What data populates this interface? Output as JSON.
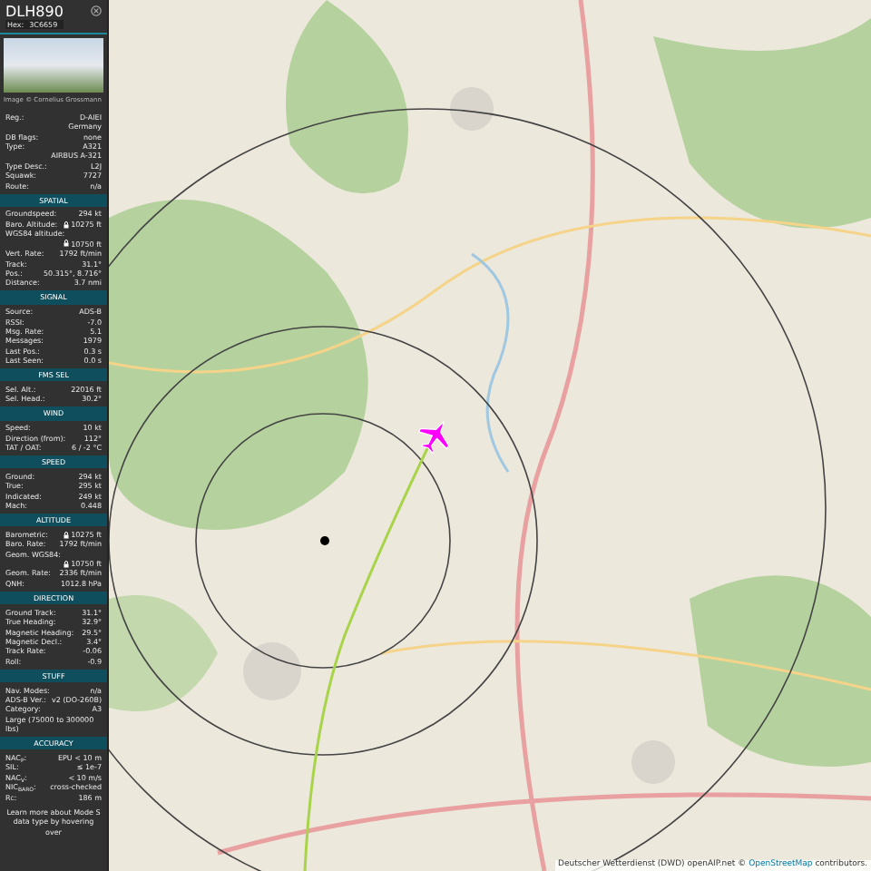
{
  "header": {
    "callsign": "DLH890",
    "hex_label": "Hex:",
    "hex": "3C6659"
  },
  "photo": {
    "caption": "Image © Cornelius Grossmann"
  },
  "info": [
    {
      "label": "Reg.:",
      "values": [
        "D-AIEI",
        "Germany"
      ],
      "locked": false
    },
    {
      "label": "DB flags:",
      "values": [
        "none"
      ],
      "locked": false
    },
    {
      "label": "Type:",
      "values": [
        "A321",
        "AIRBUS A-321"
      ],
      "locked": false
    },
    {
      "label": "Type Desc.:",
      "values": [
        "L2J"
      ],
      "locked": false
    },
    {
      "label": "Squawk:",
      "values": [
        "7727"
      ],
      "locked": false
    },
    {
      "label": "Route:",
      "values": [
        "n/a"
      ],
      "locked": false
    }
  ],
  "sections": [
    {
      "title": "SPATIAL",
      "rows": [
        {
          "label": "Groundspeed:",
          "values": [
            "294 kt"
          ],
          "locked": false
        },
        {
          "label": "Baro. Altitude:",
          "values": [
            "10275 ft"
          ],
          "locked": true
        },
        {
          "label": "WGS84 altitude:",
          "values": [
            "10750 ft"
          ],
          "locked": true
        },
        {
          "label": "Vert. Rate:",
          "values": [
            "1792 ft/min"
          ],
          "locked": false
        },
        {
          "label": "Track:",
          "values": [
            "31.1°"
          ],
          "locked": false
        },
        {
          "label": "Pos.:",
          "values": [
            "50.315°, 8.716°"
          ],
          "locked": false
        },
        {
          "label": "Distance:",
          "values": [
            "3.7 nmi"
          ],
          "locked": false
        }
      ]
    },
    {
      "title": "SIGNAL",
      "rows": [
        {
          "label": "Source:",
          "values": [
            "ADS-B"
          ],
          "locked": false
        },
        {
          "label": "RSSI:",
          "values": [
            "-7.0"
          ],
          "locked": false
        },
        {
          "label": "Msg. Rate:",
          "values": [
            "5.1"
          ],
          "locked": false
        },
        {
          "label": "Messages:",
          "values": [
            "1979"
          ],
          "locked": false
        },
        {
          "label": "Last Pos.:",
          "values": [
            "0.3 s"
          ],
          "locked": false
        },
        {
          "label": "Last Seen:",
          "values": [
            "0.0 s"
          ],
          "locked": false
        }
      ]
    },
    {
      "title": "FMS SEL",
      "rows": [
        {
          "label": "Sel. Alt.:",
          "values": [
            "22016 ft"
          ],
          "locked": false
        },
        {
          "label": "Sel. Head.:",
          "values": [
            "30.2°"
          ],
          "locked": false
        }
      ]
    },
    {
      "title": "WIND",
      "rows": [
        {
          "label": "Speed:",
          "values": [
            "10 kt"
          ],
          "locked": false
        },
        {
          "label": "Direction (from):",
          "values": [
            "112°"
          ],
          "locked": false
        },
        {
          "label": "TAT / OAT:",
          "values": [
            "6 / -2 °C"
          ],
          "locked": false
        }
      ]
    },
    {
      "title": "SPEED",
      "rows": [
        {
          "label": "Ground:",
          "values": [
            "294 kt"
          ],
          "locked": false
        },
        {
          "label": "True:",
          "values": [
            "295 kt"
          ],
          "locked": false
        },
        {
          "label": "Indicated:",
          "values": [
            "249 kt"
          ],
          "locked": false
        },
        {
          "label": "Mach:",
          "values": [
            "0.448"
          ],
          "locked": false
        }
      ]
    },
    {
      "title": "ALTITUDE",
      "rows": [
        {
          "label": "Barometric:",
          "values": [
            "10275 ft"
          ],
          "locked": true
        },
        {
          "label": "Baro. Rate:",
          "values": [
            "1792 ft/min"
          ],
          "locked": false
        },
        {
          "label": "Geom. WGS84:",
          "values": [
            "10750 ft"
          ],
          "locked": true
        },
        {
          "label": "Geom. Rate:",
          "values": [
            "2336 ft/min"
          ],
          "locked": false
        },
        {
          "label": "QNH:",
          "values": [
            "1012.8 hPa"
          ],
          "locked": false
        }
      ]
    },
    {
      "title": "DIRECTION",
      "rows": [
        {
          "label": "Ground Track:",
          "values": [
            "31.1°"
          ],
          "locked": false
        },
        {
          "label": "True Heading:",
          "values": [
            "32.9°"
          ],
          "locked": false
        },
        {
          "label": "Magnetic Heading:",
          "values": [
            "29.5°"
          ],
          "locked": false
        },
        {
          "label": "Magnetic Decl.:",
          "values": [
            "3.4°"
          ],
          "locked": false
        },
        {
          "label": "Track Rate:",
          "values": [
            "-0.06"
          ],
          "locked": false
        },
        {
          "label": "Roll:",
          "values": [
            "-0.9"
          ],
          "locked": false
        }
      ]
    },
    {
      "title": "STUFF",
      "rows": [
        {
          "label": "Nav. Modes:",
          "values": [
            "n/a"
          ],
          "locked": false
        },
        {
          "label": "ADS-B Ver.:",
          "values": [
            "v2 (DO-260B)"
          ],
          "locked": false
        },
        {
          "label": "Category:",
          "values": [
            "A3"
          ],
          "locked": false
        },
        {
          "label": "Large (75000 to 300000 lbs)",
          "values": [],
          "locked": false
        }
      ]
    },
    {
      "title": "ACCURACY",
      "rows": [
        {
          "label": "NAC$_{P}$:",
          "values": [
            "EPU < 10 m"
          ],
          "locked": false
        },
        {
          "label": "SIL:",
          "values": [
            "≤ 1e-7"
          ],
          "locked": false
        },
        {
          "label": "NAC$_{V}$:",
          "values": [
            "< 10 m/s"
          ],
          "locked": false
        },
        {
          "label": "NIC$_{BARO}$:",
          "values": [
            "cross-checked"
          ],
          "locked": false
        },
        {
          "label": "R$_{C}$:",
          "values": [
            "186 m"
          ],
          "locked": false
        }
      ]
    }
  ],
  "footer": "Learn more about Mode S data type by hovering over",
  "map": {
    "attribution": "Deutscher Wetterdienst (DWD) openAIP.net ©",
    "attribution_link": "OpenStreetMap",
    "attribution_end": "contributors."
  }
}
